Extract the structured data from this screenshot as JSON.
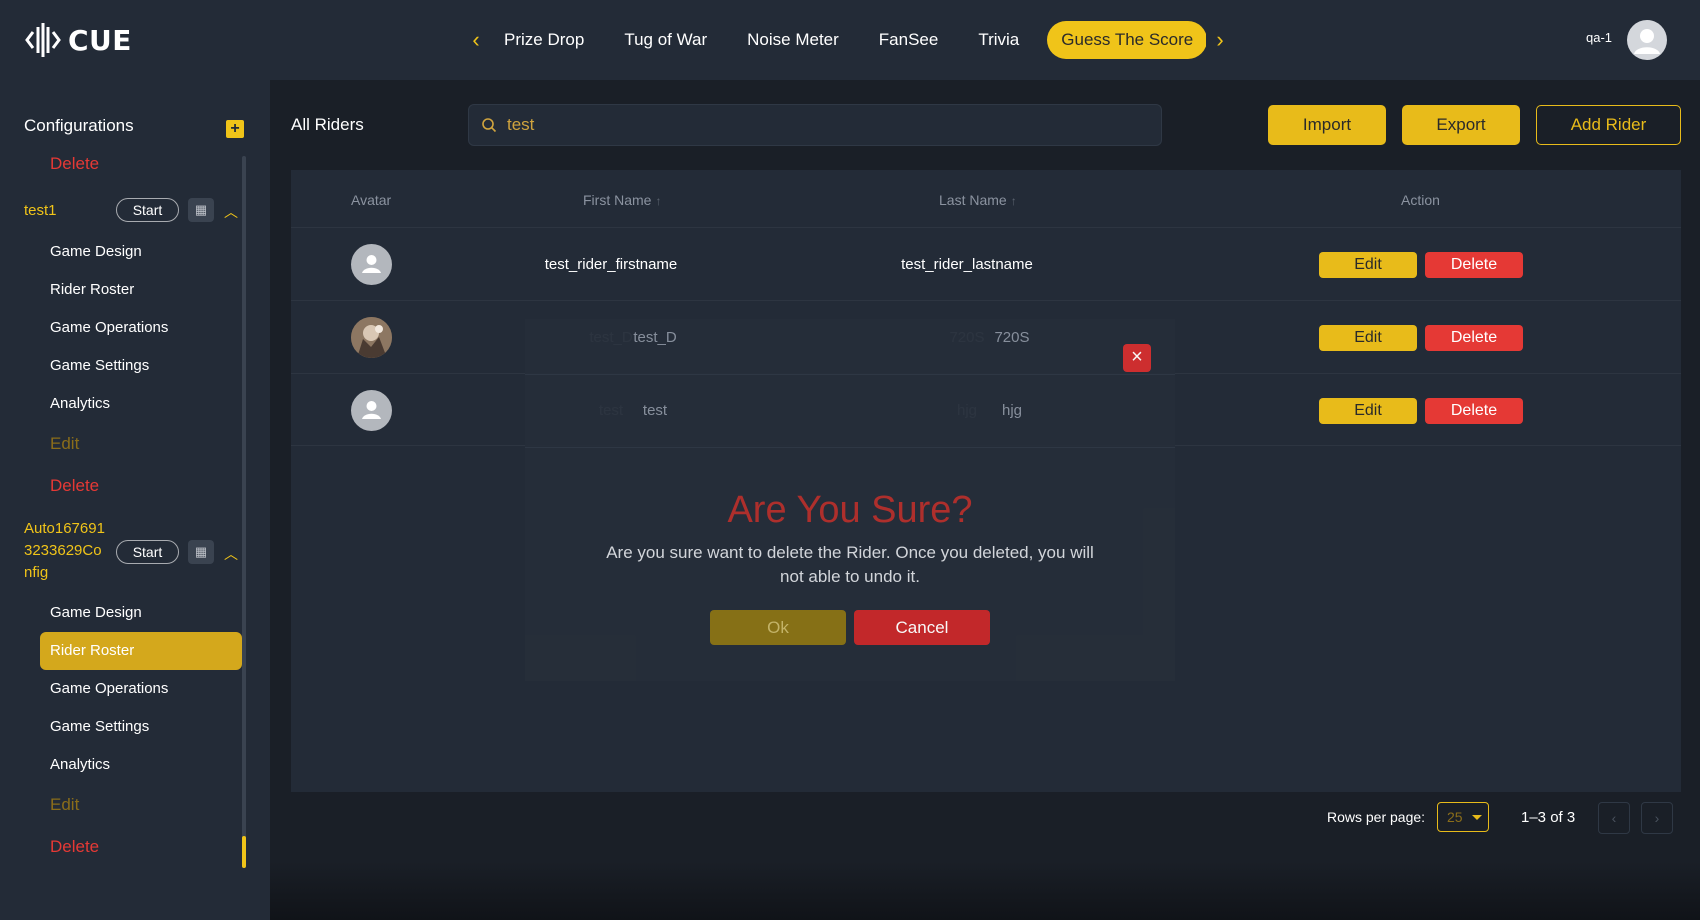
{
  "header": {
    "logo_text": "CUE",
    "tabs": [
      "Prize Drop",
      "Tug of War",
      "Noise Meter",
      "FanSee",
      "Trivia",
      "Guess The Score"
    ],
    "user_name": "qa-1",
    "accent_color": "#f0c419"
  },
  "sidebar": {
    "title": "Configurations",
    "add_icon": "plus-icon",
    "top_delete": "Delete",
    "configs": [
      {
        "name": "test1",
        "start_label": "Start",
        "items": [
          "Game Design",
          "Rider Roster",
          "Game Operations",
          "Game Settings",
          "Analytics"
        ],
        "edit_label": "Edit",
        "delete_label": "Delete"
      },
      {
        "name": "Auto1676913233629Config",
        "name_lines": [
          "Auto167691",
          "3233629Co",
          "nfig"
        ],
        "start_label": "Start",
        "items": [
          "Game Design",
          "Rider Roster",
          "Game Operations",
          "Game Settings",
          "Analytics"
        ],
        "active_item": "Rider Roster",
        "edit_label": "Edit",
        "delete_label": "Delete"
      }
    ]
  },
  "main": {
    "title": "All Riders",
    "search": {
      "value": "test",
      "icon": "search-icon"
    },
    "buttons": {
      "import": "Import",
      "export": "Export",
      "add_rider": "Add Rider"
    },
    "table": {
      "headers": {
        "avatar": "Avatar",
        "first_name": "First Name",
        "last_name": "Last Name",
        "action": "Action"
      },
      "sort_icon": "↑",
      "rows": [
        {
          "first_name": "test_rider_firstname",
          "last_name": "test_rider_lastname",
          "avatar": "default-avatar-icon"
        },
        {
          "first_name": "test_D",
          "last_name": "720S",
          "avatar": "photo-avatar"
        },
        {
          "first_name": "test",
          "last_name": "hjg",
          "avatar": "default-avatar-icon"
        }
      ],
      "edit_label": "Edit",
      "delete_label": "Delete"
    },
    "pagination": {
      "rows_per_page_label": "Rows per page:",
      "rows_per_page": "25",
      "range": "1–3 of 3"
    }
  },
  "modal": {
    "title": "Are You Sure?",
    "message": "Are you sure want to delete the Rider. Once you deleted, you will not able to undo it.",
    "ok_label": "Ok",
    "cancel_label": "Cancel",
    "close_icon": "close-icon"
  }
}
